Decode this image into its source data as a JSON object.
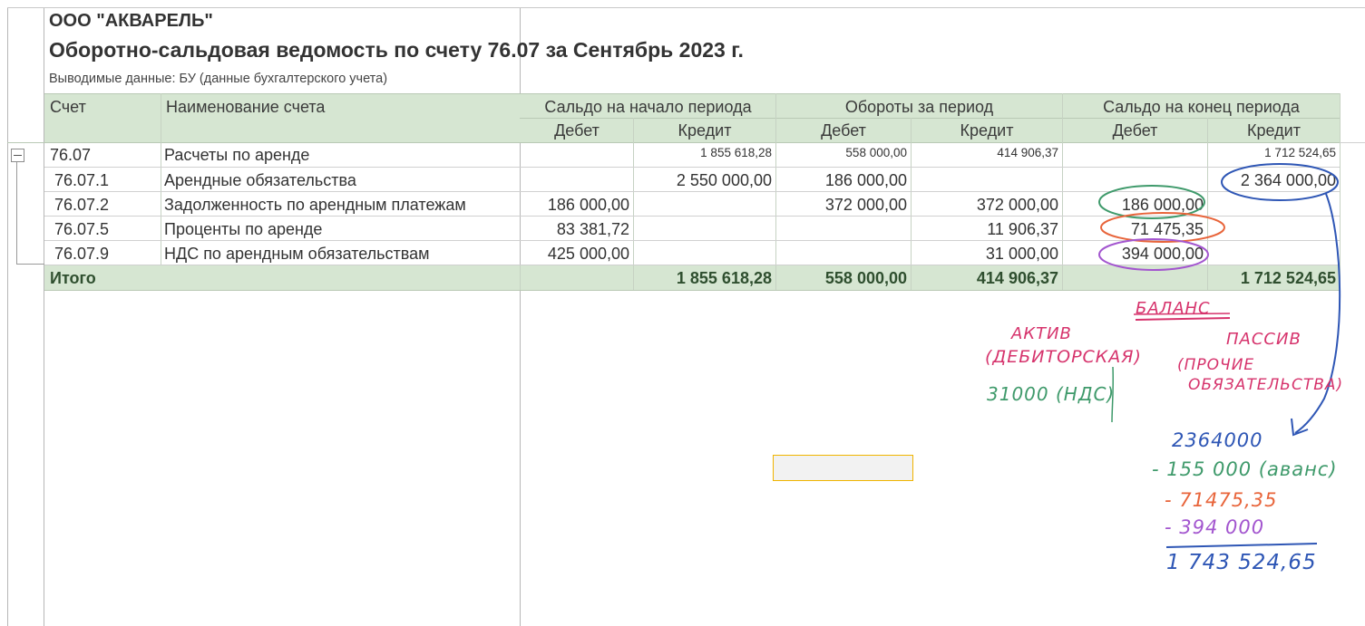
{
  "report": {
    "company": "ООО \"АКВАРЕЛЬ\"",
    "title": "Оборотно-сальдовая ведомость по счету 76.07 за Сентябрь 2023 г.",
    "subtitle": "Выводимые данные: БУ (данные бухгалтерского учета)"
  },
  "headers": {
    "account": "Счет",
    "account_name": "Наименование счета",
    "opening": "Сальдо на начало периода",
    "turnover": "Обороты за период",
    "closing": "Сальдо на конец периода",
    "debit": "Дебет",
    "credit": "Кредит"
  },
  "rows": [
    {
      "account": "76.07",
      "name": "Расчеты по аренде",
      "open_debit": "",
      "open_credit": "1 855 618,28",
      "turn_debit": "558 000,00",
      "turn_credit": "414 906,37",
      "close_debit": "",
      "close_credit": "1 712 524,65"
    },
    {
      "account": "76.07.1",
      "name": "Арендные обязательства",
      "open_debit": "",
      "open_credit": "2 550 000,00",
      "turn_debit": "186 000,00",
      "turn_credit": "",
      "close_debit": "",
      "close_credit": "2 364 000,00"
    },
    {
      "account": "76.07.2",
      "name": "Задолженность по арендным платежам",
      "open_debit": "186 000,00",
      "open_credit": "",
      "turn_debit": "372 000,00",
      "turn_credit": "372 000,00",
      "close_debit": "186 000,00",
      "close_credit": ""
    },
    {
      "account": "76.07.5",
      "name": "Проценты по аренде",
      "open_debit": "83 381,72",
      "open_credit": "",
      "turn_debit": "",
      "turn_credit": "11 906,37",
      "close_debit": "71 475,35",
      "close_credit": ""
    },
    {
      "account": "76.07.9",
      "name": "НДС по арендным обязательствам",
      "open_debit": "425 000,00",
      "open_credit": "",
      "turn_debit": "",
      "turn_credit": "31 000,00",
      "close_debit": "394 000,00",
      "close_credit": ""
    }
  ],
  "total": {
    "label": "Итого",
    "open_debit": "",
    "open_credit": "1 855 618,28",
    "turn_debit": "558 000,00",
    "turn_credit": "414 906,37",
    "close_debit": "",
    "close_credit": "1 712 524,65"
  },
  "notes": {
    "balance": "БАЛАНС",
    "asset_1": "АКТИВ",
    "asset_2": "(ДЕБИТОРСКАЯ)",
    "asset_3": "31000 (НДС)",
    "liability_1": "ПАССИВ",
    "liability_2": "(ПРОЧИЕ",
    "liability_3": "ОБЯЗАТЕЛЬСТВА)",
    "calc_1": "2364000",
    "calc_2": "- 155 000 (аванс)",
    "calc_3": "- 71475,35",
    "calc_4": "- 394 000",
    "calc_result": "1 743 524,65"
  },
  "colors": {
    "header_bg": "#d6e6d2",
    "note_pink": "#d6336c",
    "note_green": "#3f9a6b",
    "note_blue": "#2e56b5",
    "note_orange": "#e8643a",
    "note_purple": "#a356cf",
    "active_cell_border": "#f0b400"
  }
}
